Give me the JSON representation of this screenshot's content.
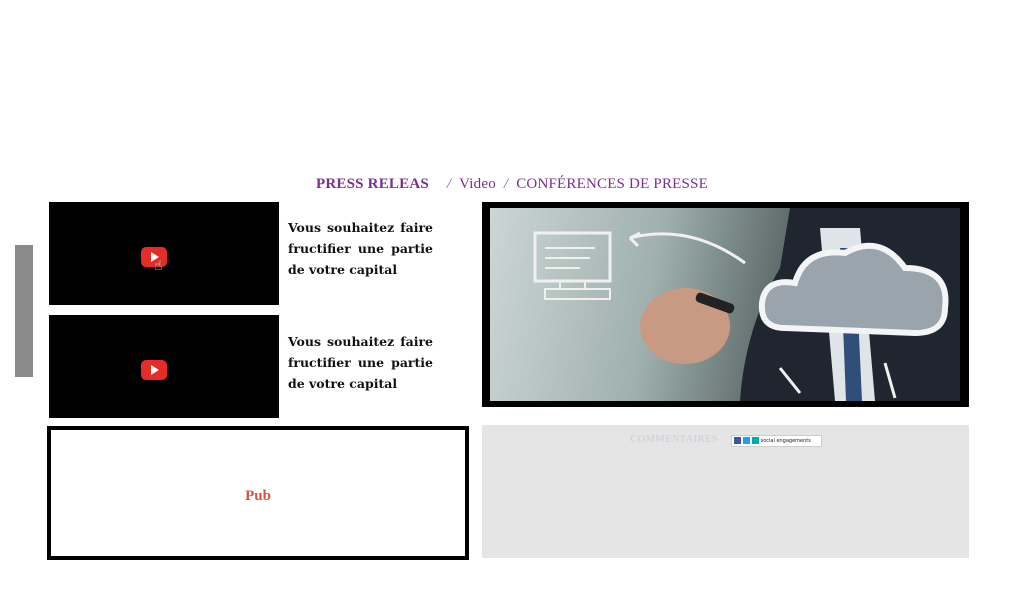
{
  "nav": {
    "press": "PRESS RELEAS",
    "sep1": "/",
    "video": "Video",
    "sep2": "/",
    "conferences": "CONFÉRENCES DE PRESSE"
  },
  "videos": [
    {
      "text": "Vous souhaitez faire fructifier une partie de votre capital",
      "icon": "youtube-play-icon"
    },
    {
      "text": "Vous souhaitez faire fructifier une partie de votre capital",
      "icon": "youtube-play-icon"
    }
  ],
  "pub": {
    "label": "Pub"
  },
  "comments": {
    "title": "COMMENTAIRES",
    "widget_text": "social engagements"
  },
  "colors": {
    "accent": "#7a2f8f",
    "pub": "#d9533e",
    "youtube": "#e52d27"
  }
}
